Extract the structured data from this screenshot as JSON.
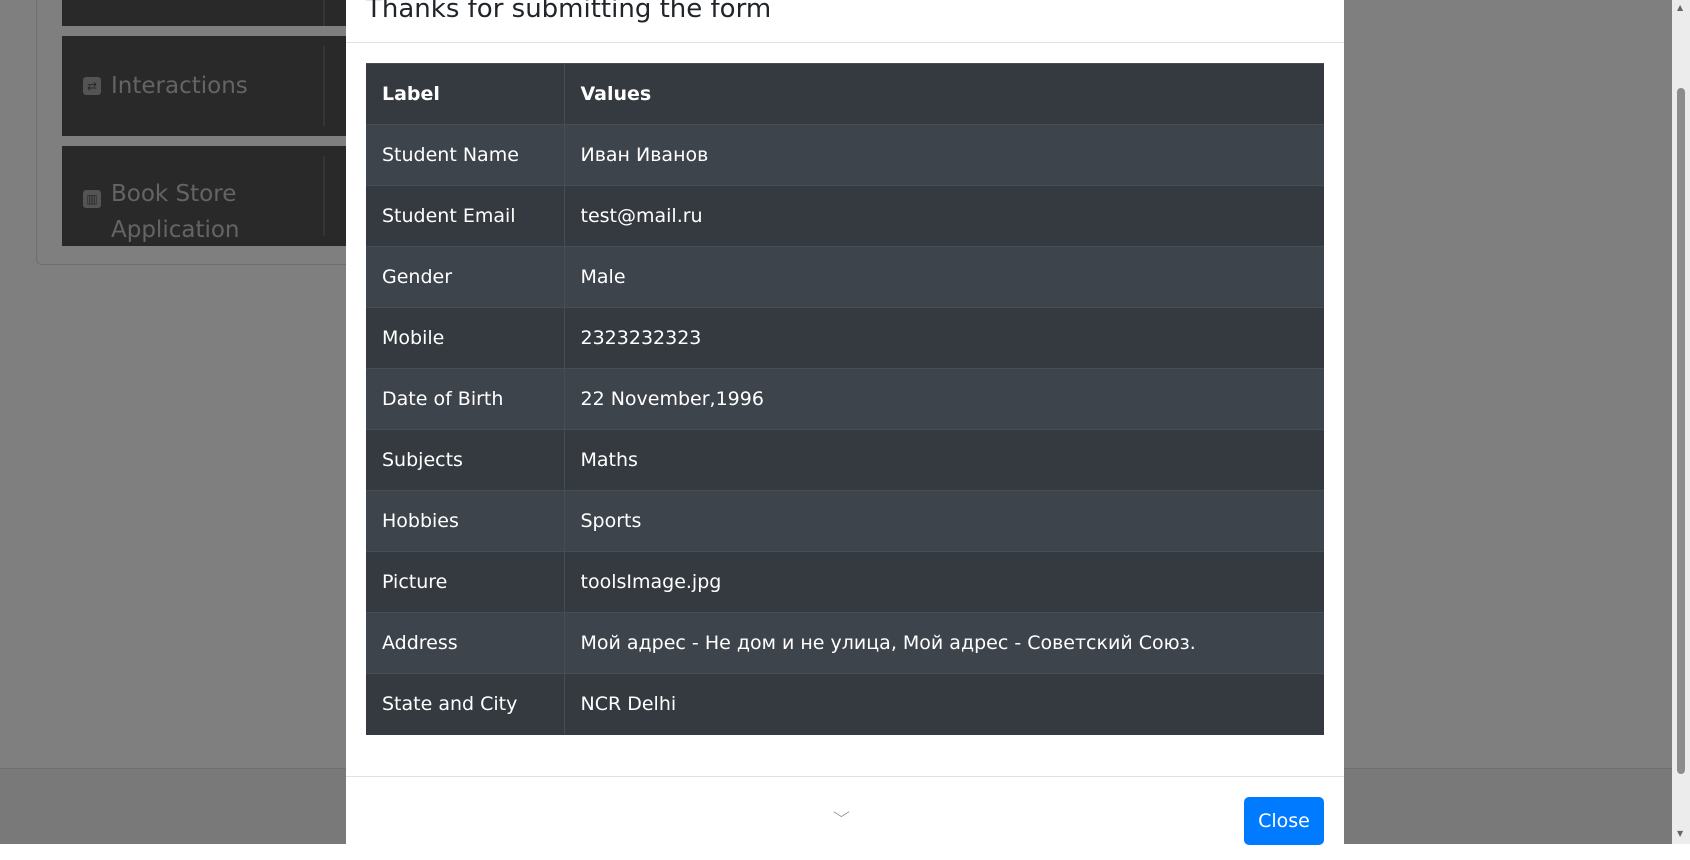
{
  "sidebar": {
    "cards": [
      {
        "label": "",
        "icon": ""
      },
      {
        "label": "Interactions",
        "icon": "interactions-icon"
      },
      {
        "label": "Book Store Application",
        "icon": "bookstore-icon"
      }
    ]
  },
  "modal": {
    "title": "Thanks for submitting the form",
    "table": {
      "headers": [
        "Label",
        "Values"
      ],
      "rows": [
        [
          "Student Name",
          "Иван Иванов"
        ],
        [
          "Student Email",
          "test@mail.ru"
        ],
        [
          "Gender",
          "Male"
        ],
        [
          "Mobile",
          "2323232323"
        ],
        [
          "Date of Birth",
          "22 November,1996"
        ],
        [
          "Subjects",
          "Maths"
        ],
        [
          "Hobbies",
          "Sports"
        ],
        [
          "Picture",
          "toolsImage.jpg"
        ],
        [
          "Address",
          "Мой адрес - Не дом и не улица, Мой адрес - Советский Союз."
        ],
        [
          "State and City",
          "NCR Delhi"
        ]
      ]
    },
    "close_label": "Close"
  },
  "colors": {
    "overlay": "#000000",
    "table_dark": "#343a40",
    "table_stripe": "#3e444b",
    "primary_button": "#007bff"
  }
}
